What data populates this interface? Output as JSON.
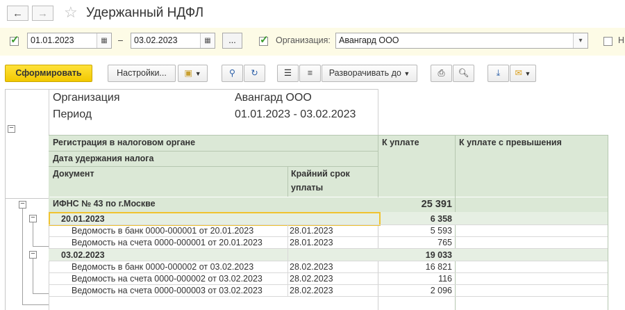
{
  "window": {
    "title": "Удержанный НДФЛ"
  },
  "params": {
    "date_from": "01.01.2023",
    "dash": "–",
    "date_to": "03.02.2023",
    "more_btn": "...",
    "org_label": "Организация:",
    "org_value": "Авангард ООО",
    "truncated_label": "Н"
  },
  "toolbar": {
    "generate": "Сформировать",
    "settings": "Настройки...",
    "expand_to": "Разворачивать до"
  },
  "report": {
    "org_label": "Организация",
    "org_value": "Авангард ООО",
    "period_label": "Период",
    "period_value": "01.01.2023 - 03.02.2023",
    "header": {
      "reg": "Регистрация в налоговом органе",
      "date": "Дата удержания налога",
      "doc": "Документ",
      "deadline_l1": "Крайний срок",
      "deadline_l2": "уплаты",
      "to_pay": "К уплате",
      "to_pay_excess": "К уплате с превышения"
    },
    "group": {
      "name": "ИФНС № 43 по г.Москве",
      "sum": "25 391"
    },
    "dates": [
      {
        "date": "20.01.2023",
        "sum": "6 358",
        "docs": [
          {
            "name": "Ведомость в банк 0000-000001 от 20.01.2023",
            "deadline": "28.01.2023",
            "sum": "5 593"
          },
          {
            "name": "Ведомость на счета 0000-000001 от 20.01.2023",
            "deadline": "28.01.2023",
            "sum": "765"
          }
        ]
      },
      {
        "date": "03.02.2023",
        "sum": "19 033",
        "docs": [
          {
            "name": "Ведомость в банк 0000-000002 от 03.02.2023",
            "deadline": "28.02.2023",
            "sum": "16 821"
          },
          {
            "name": "Ведомость на счета 0000-000002 от 03.02.2023",
            "deadline": "28.02.2023",
            "sum": "116"
          },
          {
            "name": "Ведомость на счета 0000-000003 от 03.02.2023",
            "deadline": "28.02.2023",
            "sum": "2 096"
          }
        ]
      }
    ]
  }
}
